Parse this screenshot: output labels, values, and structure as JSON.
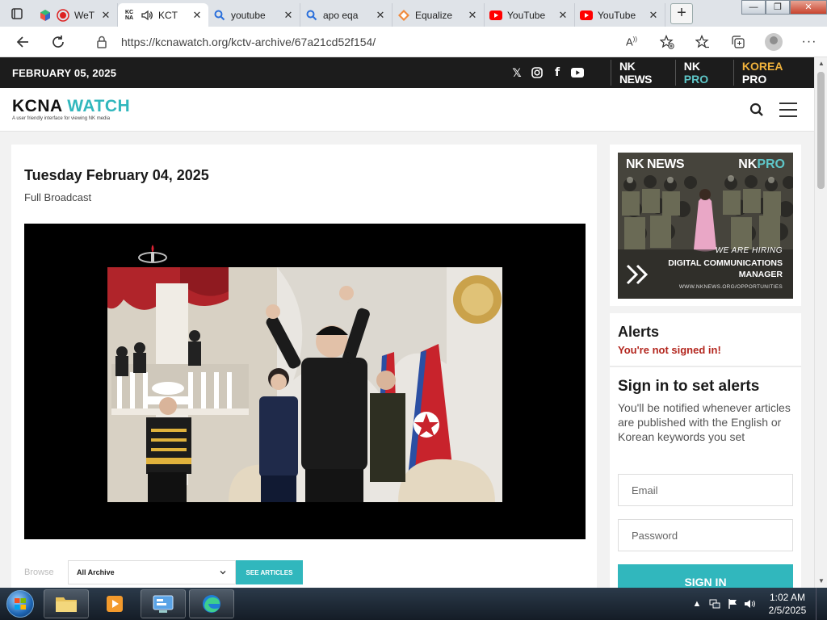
{
  "browser": {
    "tabs": [
      {
        "title": "WeT",
        "favicon": "webcam-icon"
      },
      {
        "title": "KCT",
        "favicon": "kcna-icon",
        "active": true
      },
      {
        "title": "youtube",
        "favicon": "search-icon"
      },
      {
        "title": "apo eqa",
        "favicon": "search-icon"
      },
      {
        "title": "Equalize",
        "favicon": "equalizer-icon"
      },
      {
        "title": "YouTube",
        "favicon": "youtube-icon"
      },
      {
        "title": "YouTube",
        "favicon": "youtube-icon"
      }
    ],
    "new_tab": "+",
    "url": "https://kcnawatch.org/kctv-archive/67a21cd52f154/",
    "window_controls": {
      "minimize": "—",
      "maximize": "❐",
      "close": "✕"
    }
  },
  "site": {
    "date": "FEBRUARY 05, 2025",
    "socials": [
      "x-icon",
      "instagram-icon",
      "facebook-icon",
      "youtube-icon"
    ],
    "brands": {
      "nknews": "NK NEWS",
      "nkpro_a": "NK ",
      "nkpro_b": "PRO",
      "korea_a": "KOREA ",
      "korea_b": "PRO"
    },
    "logo_main": "KCNA ",
    "logo_accent": "WATCH",
    "logo_tagline": "A user friendly interface for viewing NK media"
  },
  "main": {
    "title": "Tuesday February 04, 2025",
    "subtitle": "Full Broadcast",
    "browse_label": "Browse",
    "browse_select": "All Archive",
    "see_articles": "SEE ARTICLES"
  },
  "ad": {
    "nknews": "NK NEWS",
    "nkpro_a": "NK",
    "nkpro_b": "PRO",
    "hiring": "WE ARE HIRING",
    "role_1": "DIGITAL COMMUNICATIONS",
    "role_2": "MANAGER",
    "url": "WWW.NKNEWS.ORG/OPPORTUNITIES"
  },
  "alerts": {
    "heading": "Alerts",
    "not_signed": "You're not signed in!"
  },
  "signin": {
    "heading": "Sign in to set alerts",
    "description": "You'll be notified whenever articles are published with the English or Korean keywords you set",
    "email_placeholder": "Email",
    "password_placeholder": "Password",
    "button": "SIGN IN"
  },
  "taskbar": {
    "time": "1:02 AM",
    "date": "2/5/2025"
  },
  "colors": {
    "accent": "#31b7bd",
    "alert_red": "#b3261e",
    "header_dark": "#1c1c1c",
    "korea_pro": "#f0b23c"
  }
}
